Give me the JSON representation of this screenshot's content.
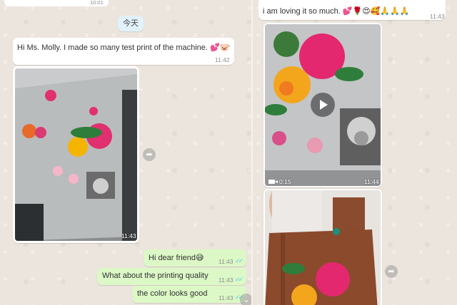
{
  "left_chat": {
    "top_time": "10:01",
    "date_separator": "今天",
    "messages": [
      {
        "text": "Hi Ms. Molly. I made so many test print of the machine. 💕🐷",
        "time": "11:42"
      },
      {
        "image_time": "11:43"
      },
      {
        "text": "Hi dear friend😅",
        "time": "11:43"
      },
      {
        "text": "What about the printing quality",
        "time": "11:43"
      },
      {
        "text": "the color looks good",
        "time": "11:43"
      }
    ]
  },
  "right_chat": {
    "messages": [
      {
        "text": "i am loving it so much. 💕🌹😍🥰🙏🙏🙏",
        "time": "11:43"
      },
      {
        "video_duration": "0:15",
        "time": "11:44"
      }
    ]
  },
  "icons": [
    "forward-icon",
    "chevron-down-icon",
    "play-icon",
    "video-camera-icon",
    "double-check-icon"
  ],
  "colors": {
    "incoming": "#ffffff",
    "outgoing": "#dcf8c6",
    "read_ticks": "#4fc3f7",
    "background": "#ece5dd"
  }
}
